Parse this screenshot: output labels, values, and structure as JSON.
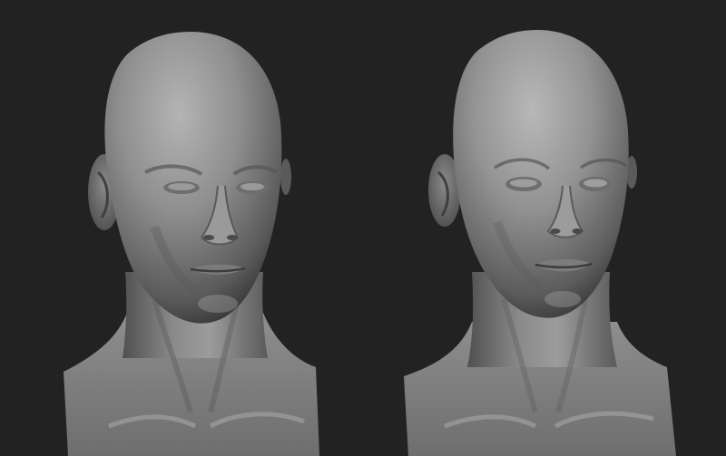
{
  "scene": {
    "background": "#222222",
    "material_color": "#8a8a8a",
    "busts": [
      {
        "id": "bust-male"
      },
      {
        "id": "bust-female"
      }
    ]
  }
}
